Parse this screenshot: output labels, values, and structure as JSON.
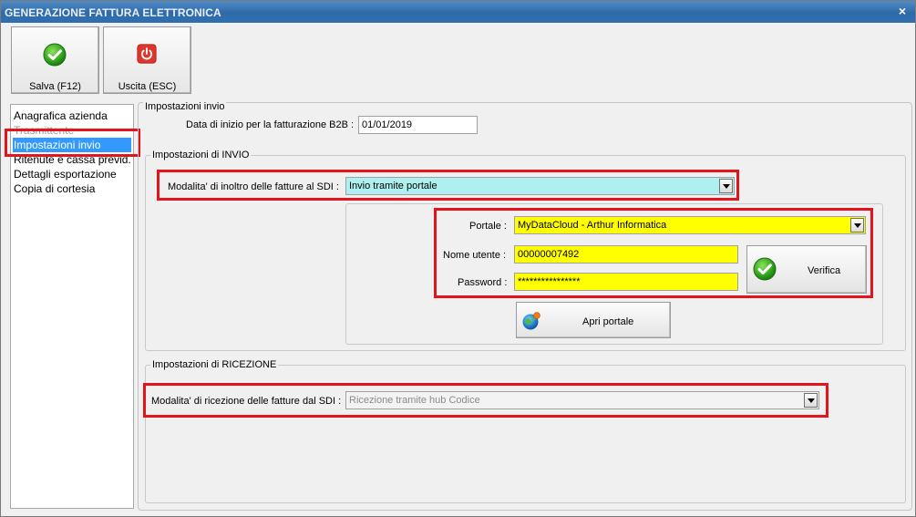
{
  "window": {
    "title": "GENERAZIONE FATTURA ELETTRONICA",
    "close_glyph": "×"
  },
  "toolbar": {
    "save_label": "Salva (F12)",
    "save_icon": "check-circle-icon",
    "exit_label": "Uscita (ESC)",
    "exit_icon": "power-icon"
  },
  "sidebar": {
    "items": [
      {
        "label": "Anagrafica azienda"
      },
      {
        "label": "Trasmittente"
      },
      {
        "label": "Impostazioni invio"
      },
      {
        "label": "Ritenute e cassa previd."
      },
      {
        "label": "Dettagli esportazione"
      },
      {
        "label": "Copia di cortesia"
      }
    ],
    "selected_index": 2
  },
  "main": {
    "section_title": "Impostazioni invio",
    "start_date_label": "Data di inizio per la fatturazione B2B :",
    "start_date_value": "01/01/2019",
    "invio": {
      "group_title": "Impostazioni di INVIO",
      "mode_label": "Modalita' di inoltro delle fatture al SDI :",
      "mode_value": "Invio tramite portale",
      "portal_label": "Portale :",
      "portal_value": "MyDataCloud - Arthur Informatica",
      "username_label": "Nome utente :",
      "username_value": "00000007492",
      "password_label": "Password :",
      "password_value": "****************",
      "verify_label": "Verifica",
      "open_portal_label": "Apri portale"
    },
    "ricezione": {
      "group_title": "Impostazioni di RICEZIONE",
      "mode_label": "Modalita' di ricezione delle fatture dal SDI :",
      "mode_value": "Ricezione tramite hub Codice"
    }
  },
  "colors": {
    "highlight_red": "#e3141b",
    "selection_blue": "#3399ff",
    "invio_combo_bg": "#aef0f0",
    "credential_fields_bg": "#ffff00",
    "titlebar_blue": "#2f6aa8"
  }
}
